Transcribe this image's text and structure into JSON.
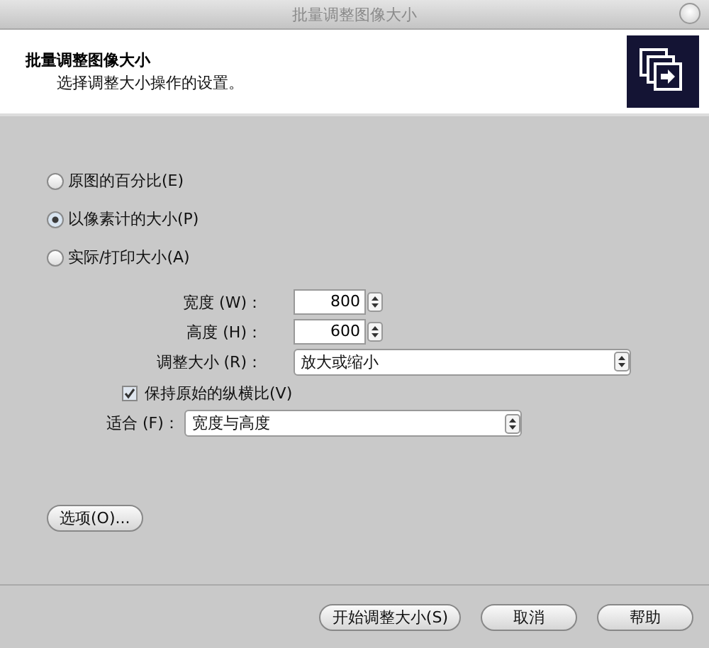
{
  "window": {
    "title": "批量调整图像大小"
  },
  "header": {
    "title": "批量调整图像大小",
    "subtitle": "选择调整大小操作的设置。"
  },
  "size_modes": [
    {
      "label": "原图的百分比(E)",
      "selected": false
    },
    {
      "label": "以像素计的大小(P)",
      "selected": true
    },
    {
      "label": "实际/打印大小(A)",
      "selected": false
    }
  ],
  "fields": [
    {
      "kind": "spinner",
      "label": "宽度 (W)：",
      "value": "800"
    },
    {
      "kind": "spinner",
      "label": "高度 (H)：",
      "value": "600"
    },
    {
      "kind": "select",
      "label": "调整大小 (R)：",
      "value": "放大或缩小"
    }
  ],
  "keep_aspect": {
    "label": "保持原始的纵横比(V)",
    "checked": true
  },
  "fit": {
    "label": "适合 (F)：",
    "value": "宽度与高度"
  },
  "options_button": "选项(O)...",
  "buttons": [
    "开始调整大小(S)",
    "取消",
    "帮助"
  ]
}
